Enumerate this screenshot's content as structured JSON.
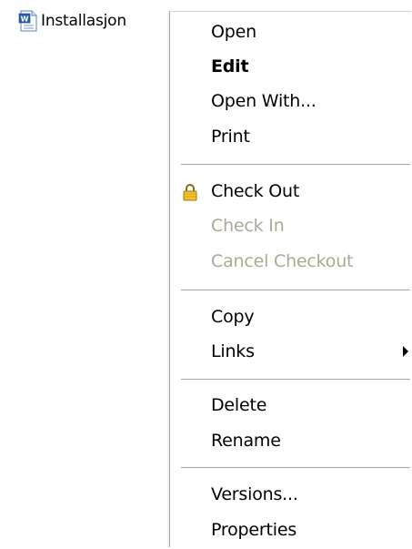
{
  "file": {
    "name": "Installasjon",
    "icon": "word-document-icon"
  },
  "menu": {
    "items": [
      {
        "label": "Open"
      },
      {
        "label": "Edit"
      },
      {
        "label": "Open With..."
      },
      {
        "label": "Print"
      },
      {
        "label": "Check Out",
        "icon": "lock-icon"
      },
      {
        "label": "Check In"
      },
      {
        "label": "Cancel Checkout"
      },
      {
        "label": "Copy"
      },
      {
        "label": "Links",
        "icon": "chevron-right-icon"
      },
      {
        "label": "Delete"
      },
      {
        "label": "Rename"
      },
      {
        "label": "Versions..."
      },
      {
        "label": "Properties"
      }
    ]
  },
  "colors": {
    "disabled_text": "#aca899",
    "separator": "#aca899",
    "text": "#000000"
  }
}
